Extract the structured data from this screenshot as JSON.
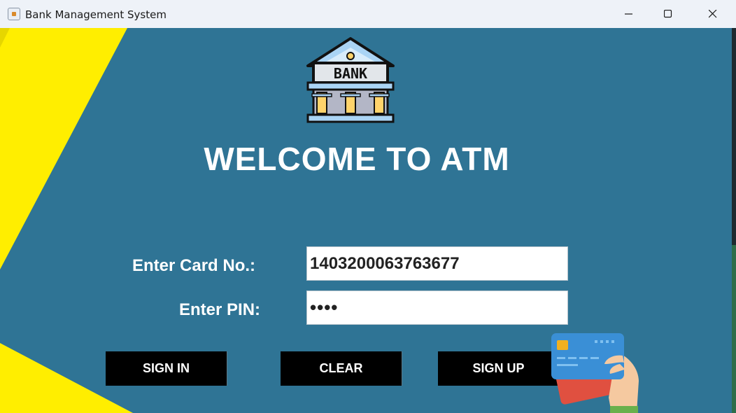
{
  "window": {
    "title": "Bank Management System",
    "controls": [
      "minimize",
      "maximize",
      "close"
    ]
  },
  "logo": {
    "text": "BANK"
  },
  "heading": "WELCOME TO ATM",
  "form": {
    "card_label": "Enter Card No.:",
    "card_value": "1403200063763677",
    "pin_label": "Enter PIN:",
    "pin_masked": "••••"
  },
  "buttons": {
    "sign_in": "SIGN IN",
    "clear": "CLEAR",
    "sign_up": "SIGN UP"
  },
  "colors": {
    "background": "#2f7495",
    "accent_stripe": "#ffee00",
    "button_bg": "#000000"
  }
}
